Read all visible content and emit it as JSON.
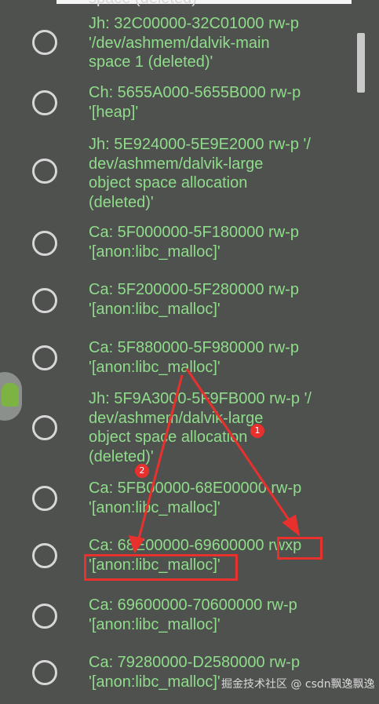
{
  "header_fragment": "space (deleted)",
  "items": [
    {
      "label": "Jh: 32C00000-32C01000 rw-p\n'/dev/ashmem/dalvik-main\nspace 1 (deleted)'"
    },
    {
      "label": "Ch: 5655A000-5655B000 rw-p\n'[heap]'"
    },
    {
      "label": "Jh: 5E924000-5E9E2000 rw-p '/\ndev/ashmem/dalvik-large\nobject space allocation\n(deleted)'"
    },
    {
      "label": "Ca: 5F000000-5F180000 rw-p\n'[anon:libc_malloc]'"
    },
    {
      "label": "Ca: 5F200000-5F280000 rw-p\n'[anon:libc_malloc]'"
    },
    {
      "label": "Ca: 5F880000-5F980000 rw-p\n'[anon:libc_malloc]'"
    },
    {
      "label": "Jh: 5F9A3000-5F9FB000 rw-p '/\ndev/ashmem/dalvik-large\nobject space allocation\n(deleted)'"
    },
    {
      "label": "Ca: 5FB00000-68E00000 rw-p\n'[anon:libc_malloc]'"
    },
    {
      "label": "Ca: 68E00000-69600000 rwxp\n'[anon:libc_malloc]'"
    },
    {
      "label": "Ca: 69600000-70600000 rw-p\n'[anon:libc_malloc]'"
    },
    {
      "label": "Ca: 79280000-D2580000 rw-p\n'[anon:libc_malloc]'"
    }
  ],
  "annotations": {
    "badge_1": "1",
    "badge_2": "2"
  },
  "watermark": "掘金技术社区 @ csdn飘逸飘逸",
  "colors": {
    "label_text": "#8fdc8a",
    "dialog_bg": "#4f514f",
    "annotation_red": "#e8302d"
  }
}
